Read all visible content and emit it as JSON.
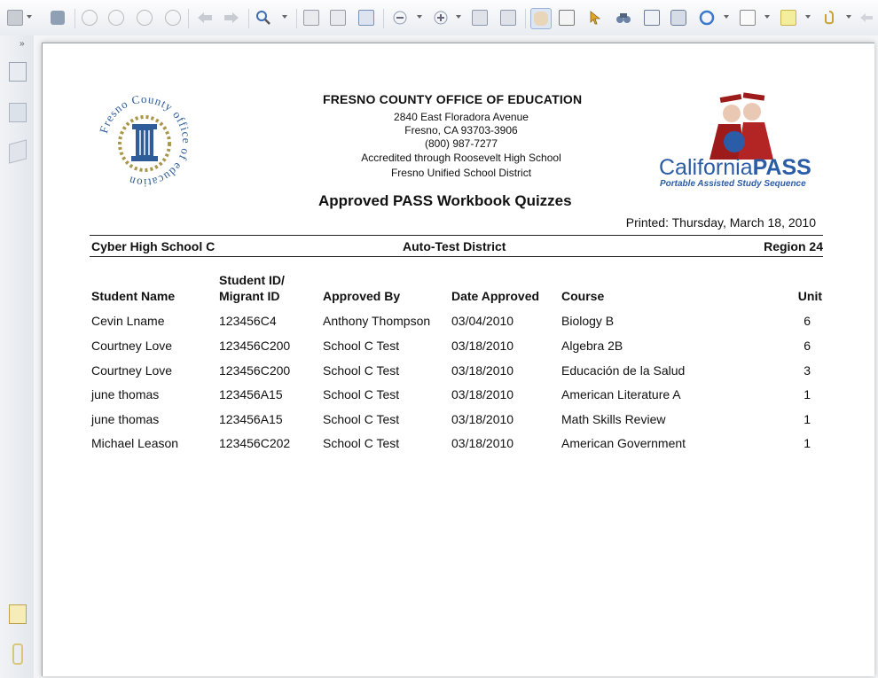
{
  "header": {
    "org_name": "FRESNO COUNTY OFFICE OF EDUCATION",
    "address_lines": [
      "2840 East Floradora Avenue",
      "Fresno, CA 93703-3906",
      "(800) 987-7277",
      "Accredited through Roosevelt High School",
      "Fresno Unified School District"
    ],
    "seal_text": "Fresno County office of education",
    "pass_logo_text": "CaliforniaPASS",
    "pass_logo_sub": "Portable Assisted Study Sequence"
  },
  "report": {
    "title": "Approved PASS Workbook Quizzes",
    "printed": "Printed:  Thursday, March 18, 2010",
    "school": "Cyber High School C",
    "district": "Auto-Test District",
    "region": "Region 24"
  },
  "table": {
    "headers": {
      "student_name": "Student Name",
      "student_id_line1": "Student ID/",
      "student_id_line2": "Migrant ID",
      "approved_by": "Approved By",
      "date_approved": "Date Approved",
      "course": "Course",
      "unit": "Unit"
    },
    "rows": [
      {
        "name": "Cevin Lname",
        "id": "123456C4",
        "approved_by": "Anthony Thompson",
        "date": "03/04/2010",
        "course": "Biology B",
        "unit": "6"
      },
      {
        "name": "Courtney Love",
        "id": "123456C200",
        "approved_by": "School C Test",
        "date": "03/18/2010",
        "course": "Algebra 2B",
        "unit": "6"
      },
      {
        "name": "Courtney Love",
        "id": "123456C200",
        "approved_by": "School C Test",
        "date": "03/18/2010",
        "course": "Educación de la Salud",
        "unit": "3"
      },
      {
        "name": "june thomas",
        "id": "123456A15",
        "approved_by": "School C Test",
        "date": "03/18/2010",
        "course": "American Literature A",
        "unit": "1"
      },
      {
        "name": "june thomas",
        "id": "123456A15",
        "approved_by": "School C Test",
        "date": "03/18/2010",
        "course": "Math Skills Review",
        "unit": "1"
      },
      {
        "name": "Michael Leason",
        "id": "123456C202",
        "approved_by": "School C Test",
        "date": "03/18/2010",
        "course": "American Government",
        "unit": "1"
      }
    ]
  },
  "colors": {
    "seal_blue": "#2f5d9a",
    "seal_gold": "#a8974a",
    "pass_red": "#9e1b1b",
    "pass_blue": "#2b5ca8"
  },
  "toolbar_icons": [
    "save-icon",
    "print-icon",
    "first-page-icon",
    "previous-page-icon",
    "next-page-icon",
    "last-page-icon",
    "back-icon",
    "forward-icon",
    "zoom-in-icon",
    "actual-size-icon",
    "fit-page-icon",
    "fit-width-icon",
    "zoom-out-icon",
    "zoom-in-plus-icon",
    "rotate-icon",
    "crop-icon",
    "hand-tool-icon",
    "text-select-icon",
    "pointer-icon",
    "find-icon",
    "typewriter-icon",
    "snapshot-icon",
    "shape-icon",
    "note-icon",
    "highlight-icon",
    "attach-icon"
  ],
  "nav_icons": [
    "pages-icon",
    "layers-icon",
    "bookmarks-icon",
    "comments-icon",
    "attachments-icon"
  ]
}
